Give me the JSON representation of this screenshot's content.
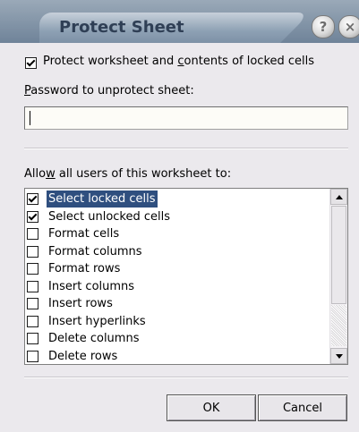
{
  "window": {
    "title": "Protect Sheet",
    "help_glyph": "?",
    "close_glyph": "×"
  },
  "protect": {
    "checked": true,
    "label_before": "Protect worksheet and ",
    "label_accel": "c",
    "label_after": "ontents of locked cells"
  },
  "password": {
    "label_accel": "P",
    "label_rest": "assword to unprotect sheet:",
    "value": "",
    "placeholder": ""
  },
  "allow": {
    "label_before": "Allo",
    "label_accel": "w",
    "label_after": " all users of this worksheet to:"
  },
  "permissions": [
    {
      "label": "Select locked cells",
      "checked": true,
      "selected": true
    },
    {
      "label": "Select unlocked cells",
      "checked": true,
      "selected": false
    },
    {
      "label": "Format cells",
      "checked": false,
      "selected": false
    },
    {
      "label": "Format columns",
      "checked": false,
      "selected": false
    },
    {
      "label": "Format rows",
      "checked": false,
      "selected": false
    },
    {
      "label": "Insert columns",
      "checked": false,
      "selected": false
    },
    {
      "label": "Insert rows",
      "checked": false,
      "selected": false
    },
    {
      "label": "Insert hyperlinks",
      "checked": false,
      "selected": false
    },
    {
      "label": "Delete columns",
      "checked": false,
      "selected": false
    },
    {
      "label": "Delete rows",
      "checked": false,
      "selected": false
    }
  ],
  "buttons": {
    "ok_label": "OK",
    "cancel_label": "Cancel"
  },
  "colors": {
    "titlebar": "#6f8399",
    "selection": "#2f4f7f",
    "dialog_bg": "#ebe9ed"
  },
  "icons": {
    "help": "help-icon",
    "close": "close-icon",
    "scroll_up": "arrow-up-icon",
    "scroll_down": "arrow-down-icon"
  }
}
